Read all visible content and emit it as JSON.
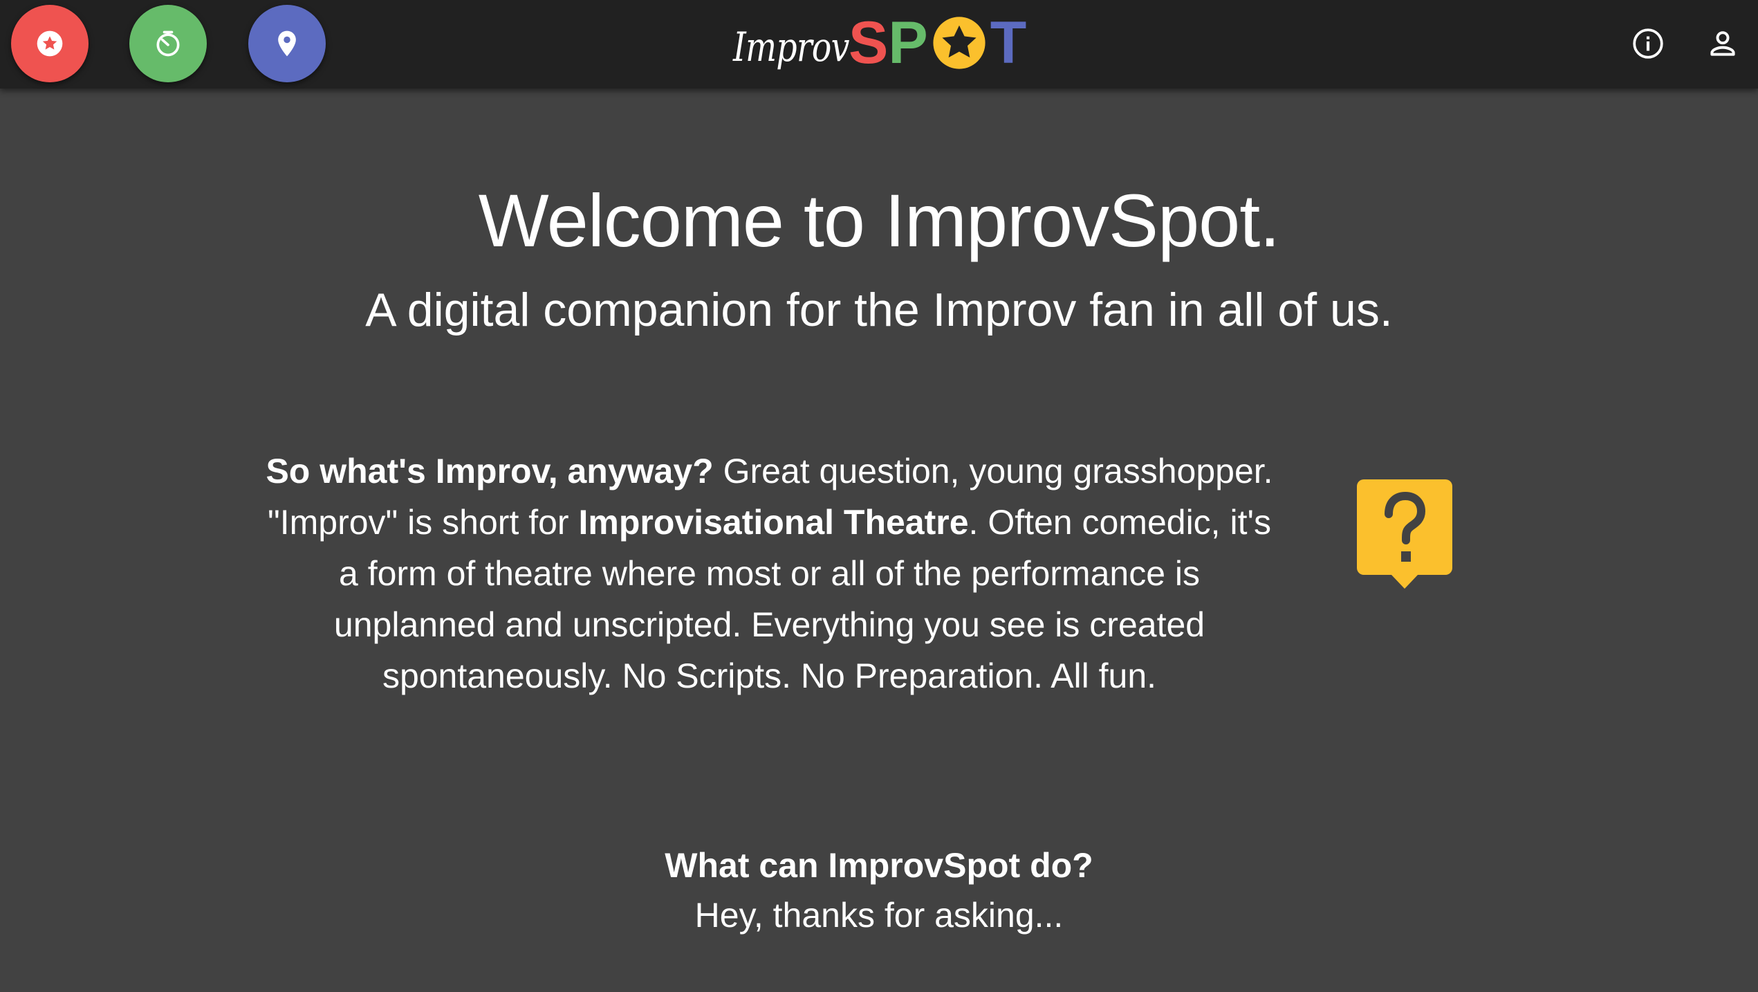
{
  "header": {
    "logo_script": "Improv",
    "logo_spot": [
      "S",
      "P",
      "O",
      "T"
    ],
    "buttons": [
      {
        "icon": "star-circle-icon",
        "color": "#ef5350"
      },
      {
        "icon": "timer-icon",
        "color": "#66bb6a"
      },
      {
        "icon": "location-pin-icon",
        "color": "#5c6bc0"
      }
    ],
    "right_icons": [
      "info-icon",
      "account-icon"
    ]
  },
  "main": {
    "welcome": "Welcome to ImprovSpot.",
    "subtitle": "A digital companion for the Improv fan in all of us.",
    "intro": {
      "q_bold": "So what's Improv, anyway?",
      "q_rest": " Great question, young grasshopper. \"Improv\" is short for ",
      "term_bold": "Improvisational Theatre",
      "rest": ". Often comedic, it's a form of theatre where most or all of the performance is unplanned and unscripted. Everything you see is created spontaneously. No Scripts. No Preparation. All fun."
    },
    "question_icon": "help-bubble-icon",
    "question_color": "#fbc02d",
    "what_title": "What can ImprovSpot do?",
    "what_sub": "Hey, thanks for asking..."
  }
}
